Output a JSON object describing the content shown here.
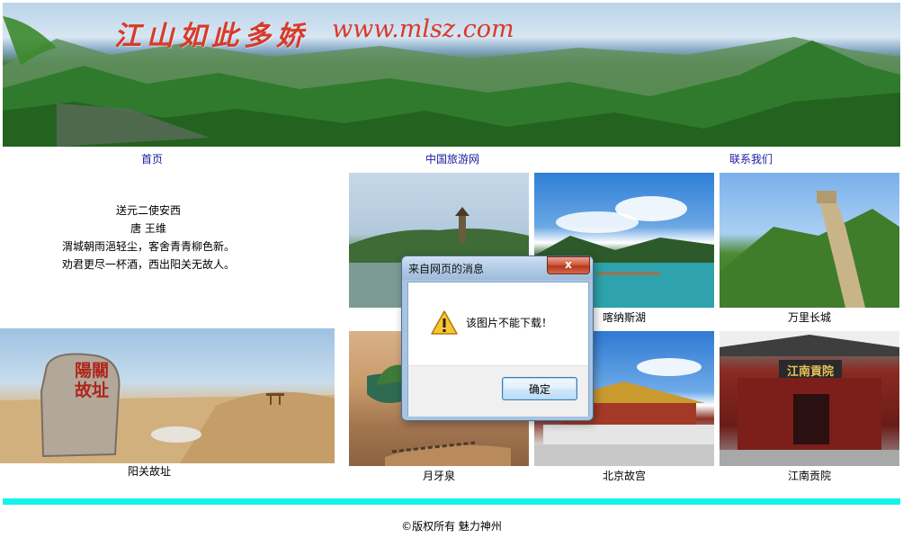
{
  "banner": {
    "title": "江山如此多娇",
    "url": "www.mlsz.com"
  },
  "nav": {
    "home": "首页",
    "china_travel": "中国旅游网",
    "contact": "联系我们"
  },
  "poem": {
    "title": "送元二使安西",
    "author": "唐 王维",
    "line1": "渭城朝雨浥轻尘，客舍青青柳色新。",
    "line2": "劝君更尽一杯酒，西出阳关无故人。"
  },
  "gallery": {
    "kanas": "喀纳斯湖",
    "great_wall": "万里长城",
    "yangguan": "阳关故址",
    "crescent_spring": "月牙泉",
    "forbidden_city": "北京故宫",
    "jiangnan": "江南贡院",
    "stele_text": "陽關故址",
    "gate_plaque": "江南貢院"
  },
  "dialog": {
    "title": "来自网页的消息",
    "close_symbol": "x",
    "message": "该图片不能下载！",
    "ok_label": "确定"
  },
  "footer": {
    "copyright": "©版权所有 魅力神州"
  },
  "colors": {
    "footer_bar": "#15f3ea",
    "nav_link": "#1a1aa0",
    "banner_text": "#d83a2a"
  }
}
